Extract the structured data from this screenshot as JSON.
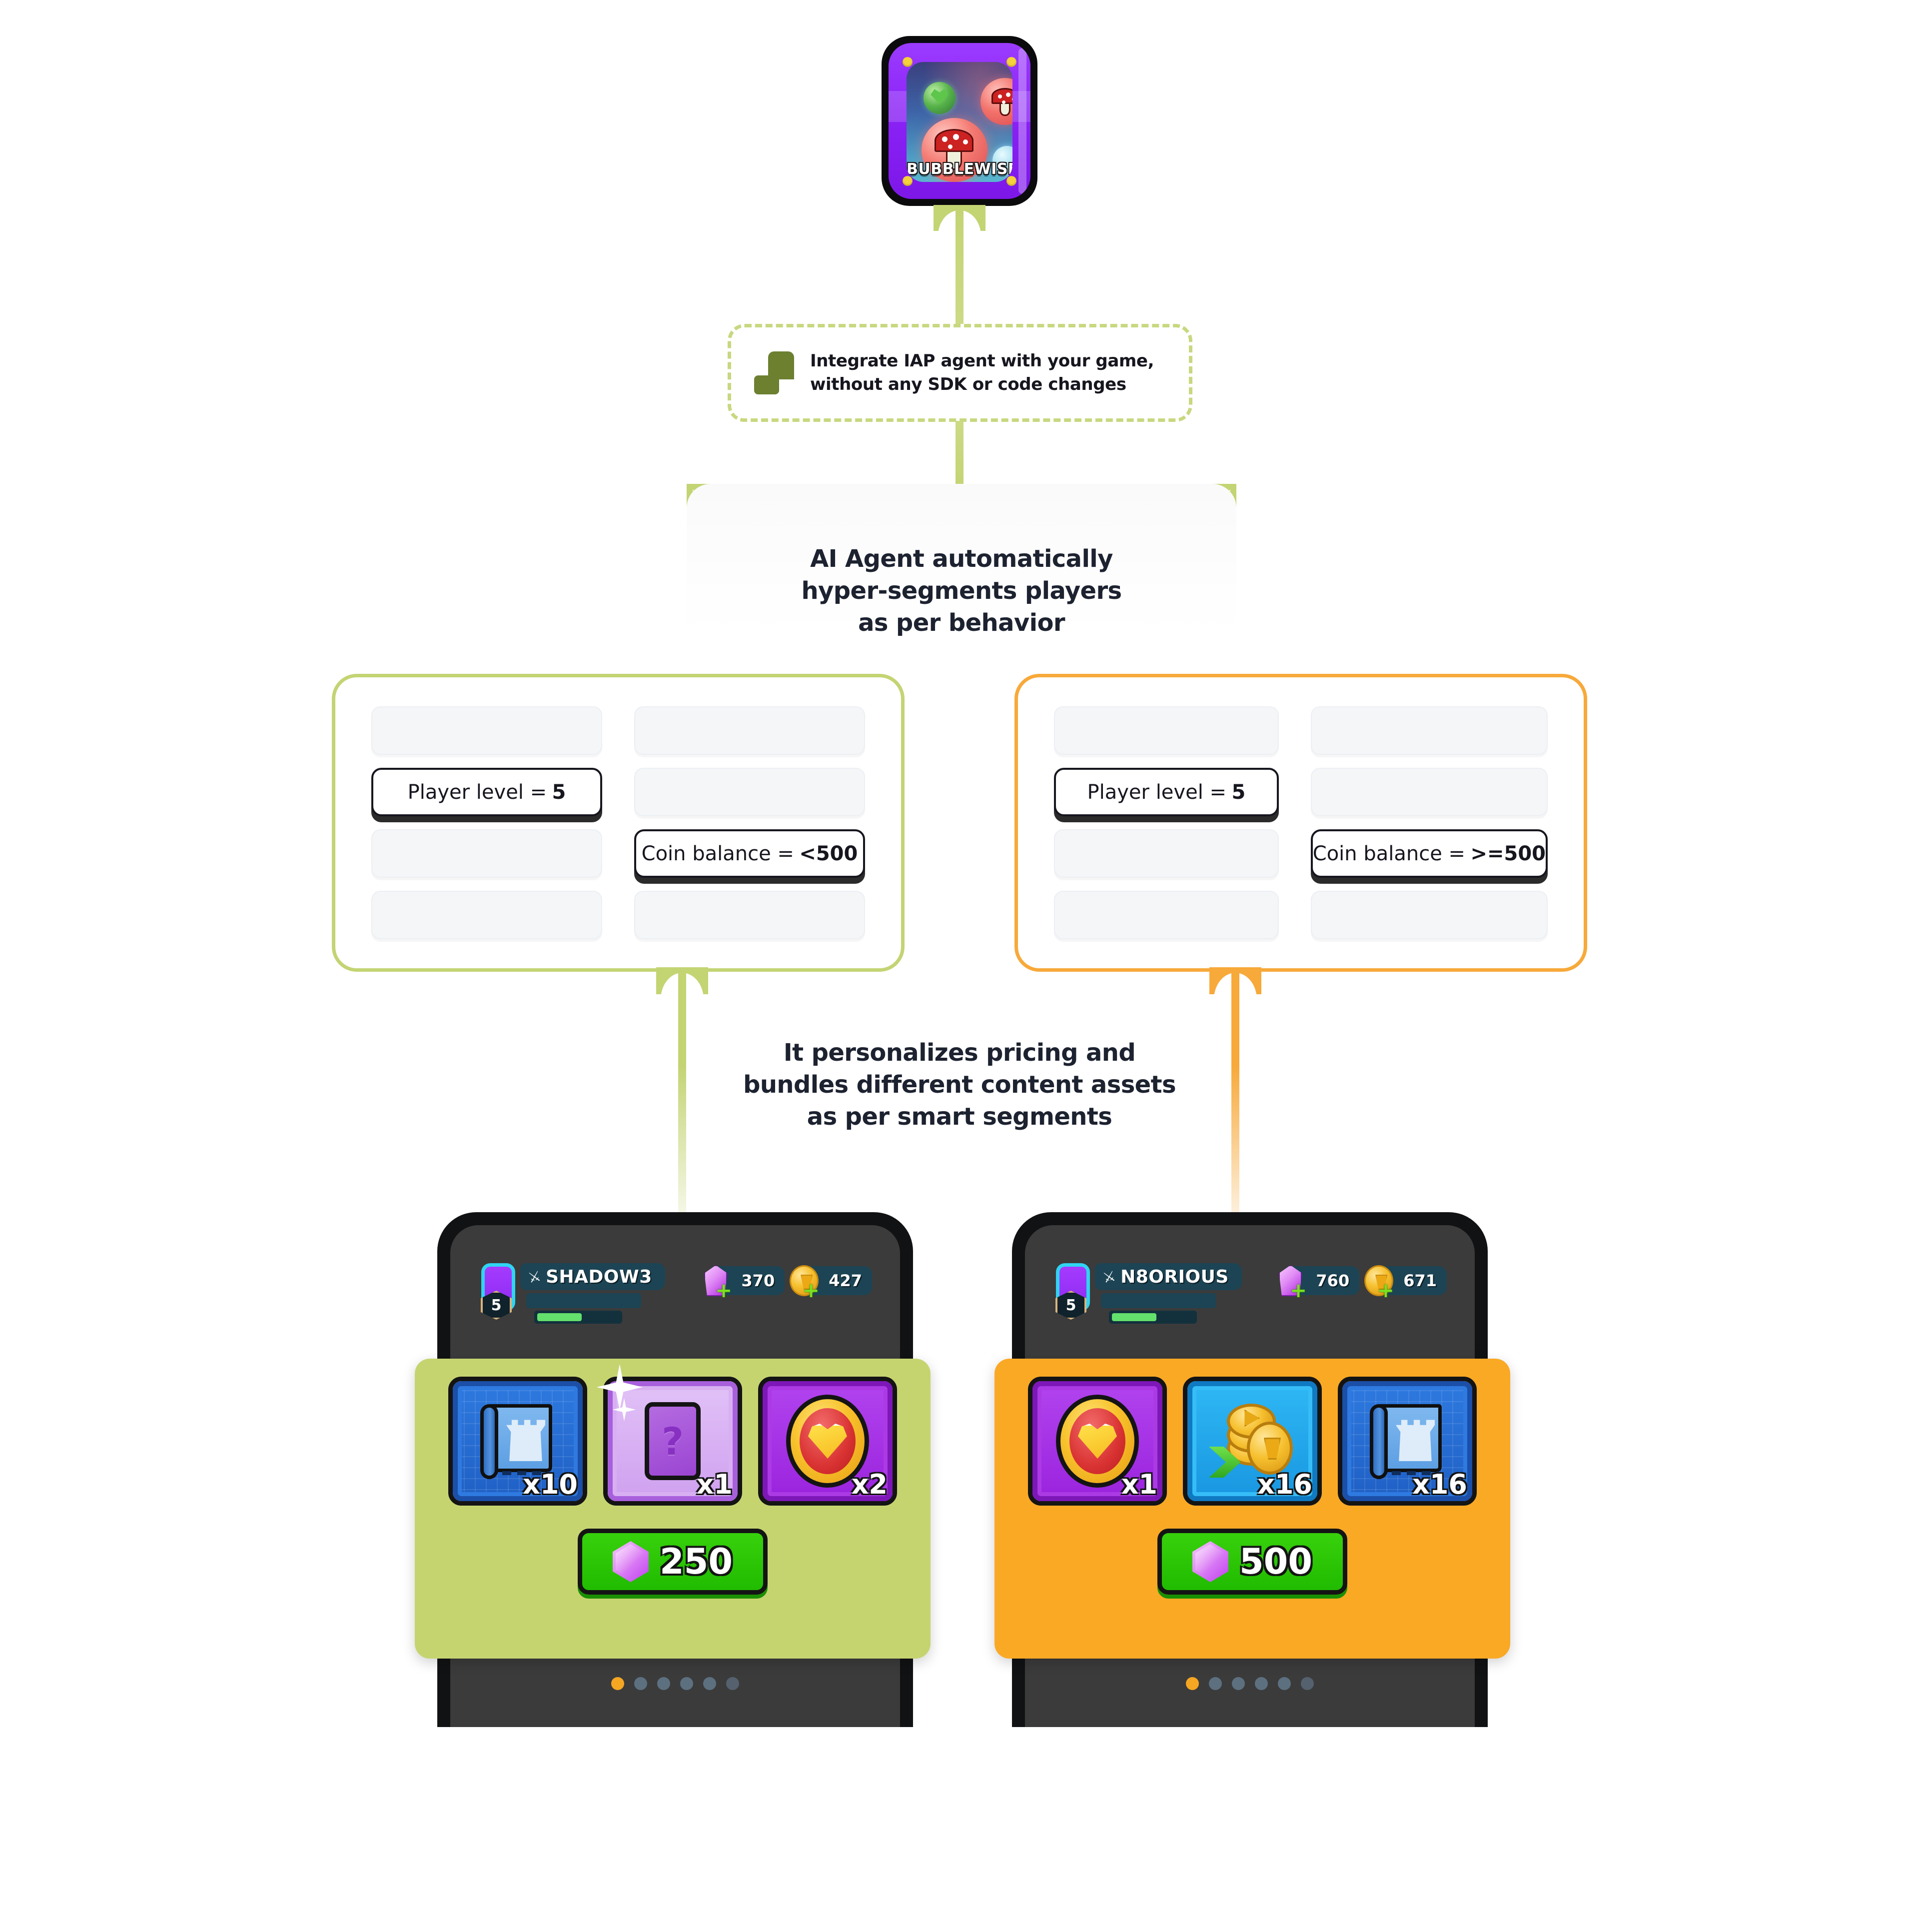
{
  "game_icon": {
    "title": "BUBBLEWISE",
    "bubble_icons": [
      "green-leaf-bubble",
      "red-mushroom-bubble",
      "red-mushroom-bubble-large",
      "blue-gem-bubble"
    ]
  },
  "integrate_step": {
    "logo_icon": "integration-blocks-icon",
    "line1": "Integrate IAP agent with your game,",
    "line2": "without any SDK or code changes",
    "border_color": "#c7d87f"
  },
  "ai_agent_step": {
    "line1": "AI Agent automatically",
    "line2": "hyper-segments players",
    "line3": "as per behavior"
  },
  "segments": [
    {
      "name": "low-balance-segment",
      "accent_color": "#c3d473",
      "rules": [
        {
          "label": "Player level =",
          "value": "5",
          "row": 2,
          "col": 1
        },
        {
          "label": "Coin balance =",
          "value": "<500",
          "row": 3,
          "col": 2
        }
      ]
    },
    {
      "name": "high-balance-segment",
      "accent_color": "#f7a93a",
      "rules": [
        {
          "label": "Player level =",
          "value": "5",
          "row": 2,
          "col": 1
        },
        {
          "label": "Coin balance =",
          "value": ">=500",
          "row": 3,
          "col": 2
        }
      ]
    }
  ],
  "personalize_step": {
    "line1": "It personalizes pricing and",
    "line2": "bundles different content assets",
    "line3": "as per smart segments"
  },
  "phones": [
    {
      "name": "phone-low-balance",
      "hud": {
        "player_name": "SHADOW3",
        "level": "5",
        "gems": "370",
        "coins": "427",
        "sword_icon": "sword-icon",
        "gem_icon": "gem-icon",
        "coin_icon": "coin-icon",
        "plus_icon": "plus-icon"
      },
      "offer": {
        "panel_color": "#c6d470",
        "items": [
          {
            "icon": "blueprint-scroll-icon",
            "qty": "x10",
            "tile": "tile-blue"
          },
          {
            "icon": "mystery-card-icon",
            "qty": "x1",
            "tile": "tile-purple-lite"
          },
          {
            "icon": "heart-medal-icon",
            "qty": "x2",
            "tile": "tile-purple"
          }
        ],
        "price": "250",
        "price_currency_icon": "gem-icon"
      },
      "page_dots": {
        "count": 6,
        "active_index": 0,
        "active_color": "#f5a623"
      }
    },
    {
      "name": "phone-high-balance",
      "hud": {
        "player_name": "N8ORIOUS",
        "level": "5",
        "gems": "760",
        "coins": "671",
        "sword_icon": "sword-icon",
        "gem_icon": "gem-icon",
        "coin_icon": "coin-icon",
        "plus_icon": "plus-icon"
      },
      "offer": {
        "panel_color": "#faa925",
        "items": [
          {
            "icon": "heart-medal-icon",
            "qty": "x1",
            "tile": "tile-purple"
          },
          {
            "icon": "coin-stack-boost-icon",
            "qty": "x16",
            "tile": "tile-cyan"
          },
          {
            "icon": "blueprint-scroll-icon",
            "qty": "x16",
            "tile": "tile-blue"
          }
        ],
        "price": "500",
        "price_currency_icon": "gem-icon"
      },
      "page_dots": {
        "count": 6,
        "active_index": 0,
        "active_color": "#f5a623"
      }
    }
  ]
}
